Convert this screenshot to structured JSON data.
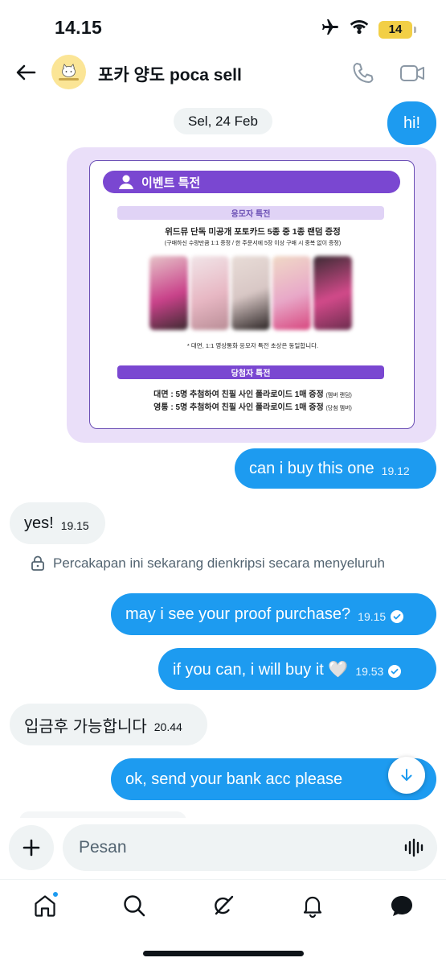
{
  "status": {
    "time": "14.15",
    "battery": "14"
  },
  "header": {
    "title": "포카 양도 poca sell"
  },
  "date_separator": "Sel, 24 Feb",
  "poster": {
    "banner": "이벤트 특전",
    "section1": "응모자 특전",
    "line1": "위드뮤 단독 미공개 포토카드 5종 중 1종 랜덤 증정",
    "line2": "(구매하신 수량만큼 1:1 증정 / 한 주문서에 5장 이상 구매 시 중복 없이 증정)",
    "note": "* 대면, 1:1 영상통화 응모자 특전 초상은 동일합니다.",
    "section2": "당첨자 특전",
    "prize1": "대면 : 5명 추첨하여 친필 사인 폴라로이드 1매 증정",
    "prize1_note": "(멤버 랜덤)",
    "prize2": "영통 : 5명 추첨하여 친필 사인 폴라로이드 1매 증정",
    "prize2_note": "(당첨 멤버)"
  },
  "messages": [
    {
      "direction": "out",
      "text": "hi!",
      "time": ""
    },
    {
      "direction": "out",
      "text": "can i buy this one",
      "time": "19.12"
    },
    {
      "direction": "in",
      "text": "yes!",
      "time": "19.15"
    },
    {
      "direction": "out",
      "text": "may i see your proof purchase?",
      "time": "19.15",
      "read": true
    },
    {
      "direction": "out",
      "text": "if you can, i will buy it 🤍",
      "time": "19.53",
      "read": true
    },
    {
      "direction": "in",
      "text": "입금후 가능합니다",
      "time": "20.44"
    },
    {
      "direction": "out",
      "text": "ok, send your bank acc please",
      "time": ""
    }
  ],
  "encryption_notice": "Percakapan ini sekarang dienkripsi secara menyeluruh",
  "composer": {
    "placeholder": "Pesan"
  },
  "colors": {
    "accent": "#1d9bf0",
    "poster_purple": "#7a47d1",
    "card_bg": "#eadff9"
  },
  "tabs": [
    "home-icon",
    "search-icon",
    "grok-icon",
    "notifications-icon",
    "messages-icon"
  ]
}
